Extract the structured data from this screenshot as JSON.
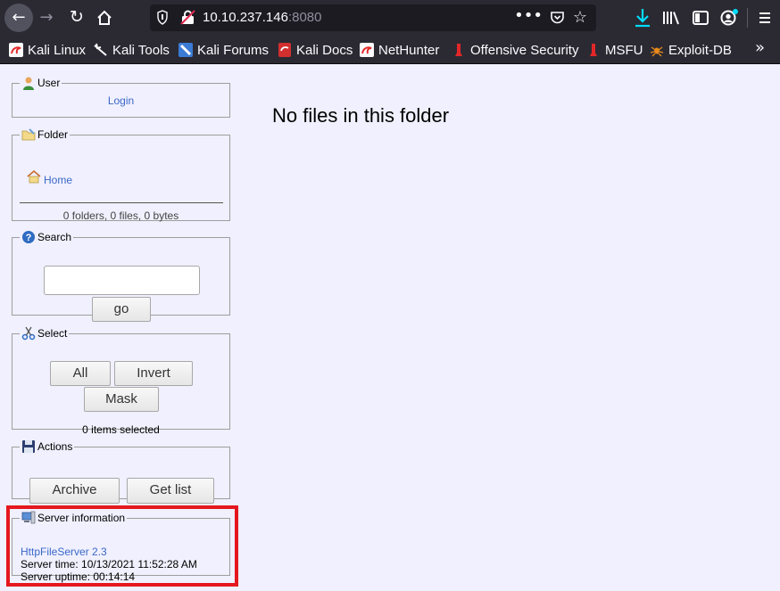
{
  "browser": {
    "url_host": "10.10.237.146",
    "url_port": ":8080",
    "menu_dots": "•••",
    "bookmarks_more": "»",
    "bookmarks": [
      {
        "label": "Kali Linux"
      },
      {
        "label": "Kali Tools"
      },
      {
        "label": "Kali Forums"
      },
      {
        "label": "Kali Docs"
      },
      {
        "label": "NetHunter"
      },
      {
        "label": "Offensive Security"
      },
      {
        "label": "MSFU"
      },
      {
        "label": "Exploit-DB"
      }
    ]
  },
  "user_panel": {
    "legend": "User",
    "login_link": "Login"
  },
  "folder_panel": {
    "legend": "Folder",
    "home_link": "Home",
    "summary": "0 folders, 0 files, 0 bytes"
  },
  "search_panel": {
    "legend": "Search",
    "input_value": "",
    "go_label": "go"
  },
  "select_panel": {
    "legend": "Select",
    "all_label": "All",
    "invert_label": "Invert",
    "mask_label": "Mask",
    "status": "0 items selected"
  },
  "actions_panel": {
    "legend": "Actions",
    "archive_label": "Archive",
    "getlist_label": "Get list"
  },
  "server_panel": {
    "legend": "Server information",
    "software_link": "HttpFileServer 2.3",
    "server_time": "Server time: 10/13/2021 11:52:28 AM",
    "server_uptime": "Server uptime: 00:14:14"
  },
  "main": {
    "message": "No files in this folder"
  },
  "colors": {
    "highlight_box": "#e4181e",
    "page_bg": "#f0f0fe",
    "link": "#3b68c8",
    "toolbar_bg": "#2b2a33"
  }
}
